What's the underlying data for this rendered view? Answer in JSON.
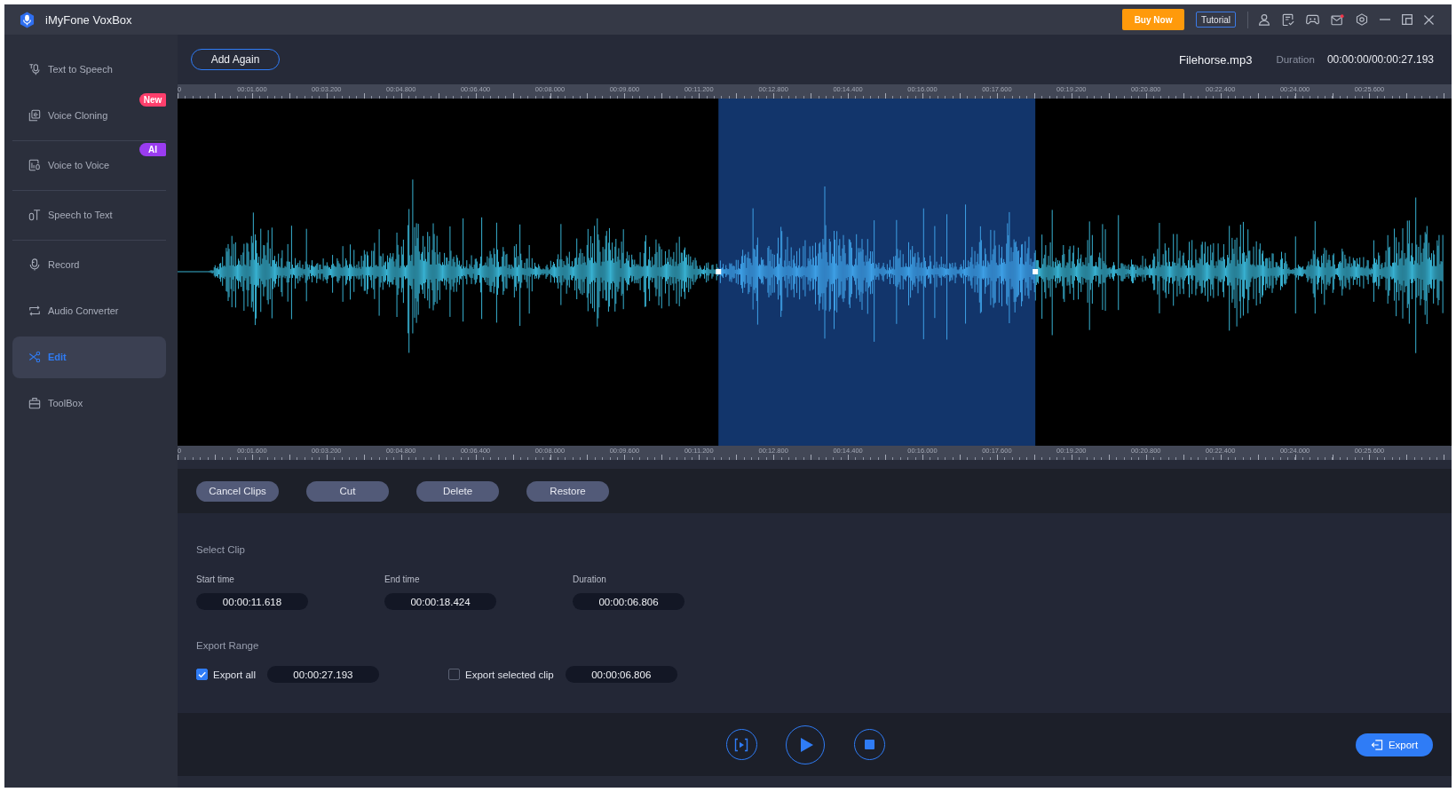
{
  "title_bar": {
    "app_name": "iMyFone VoxBox",
    "buy_button": "Buy Now",
    "tutorial_button": "Tutorial",
    "mail_unread": true
  },
  "sidebar": {
    "groups": [
      {
        "items": [
          {
            "label": "Text to Speech",
            "selected": false
          },
          {
            "label": "Voice Cloning",
            "selected": false,
            "badge": {
              "text": "New",
              "color": "#ff3f6c"
            }
          }
        ]
      },
      {
        "items": [
          {
            "label": "Voice to Voice",
            "selected": false,
            "badge": {
              "text": "AI",
              "color": "#9a3cf0"
            }
          }
        ]
      },
      {
        "items": [
          {
            "label": "Speech to Text",
            "selected": false
          }
        ]
      },
      {
        "items": [
          {
            "label": "Record",
            "selected": false
          },
          {
            "label": "Audio Converter",
            "selected": false
          },
          {
            "label": "Edit",
            "selected": true
          },
          {
            "label": "ToolBox",
            "selected": false
          }
        ]
      }
    ]
  },
  "editor": {
    "add_button": "Add Again",
    "file_name": "Filehorse.mp3",
    "duration_label": "Duration",
    "position": "00:00:00/00:00:27.193"
  },
  "top_ruler": {
    "labels": [
      "0",
      "00:01.600",
      "00:03.200",
      "00:04.800",
      "00:06.400",
      "00:08.000",
      "00:09.600",
      "00:11.200",
      "00:12.800",
      "00:14.400",
      "00:16.000",
      "00:17.600",
      "00:19.200",
      "00:20.800",
      "00:22.400",
      "00:24.000",
      "00:25.600"
    ]
  },
  "bottom_ruler": {
    "labels": [
      "0",
      "00:01.600",
      "00:03.200",
      "00:04.800",
      "00:06.400",
      "00:08.000",
      "00:09.600",
      "00:11.200",
      "00:12.800",
      "00:14.400",
      "00:16.000",
      "00:17.600",
      "00:19.200",
      "00:20.800",
      "00:22.400",
      "00:24.000",
      "00:25.600"
    ]
  },
  "clip_buttons": [
    "Cancel Clips",
    "Cut",
    "Delete",
    "Restore"
  ],
  "select_clip": {
    "title": "Select Clip",
    "fields": [
      {
        "label": "Start time",
        "value": "00:00:11.618"
      },
      {
        "label": "End time",
        "value": "00:00:18.424"
      },
      {
        "label": "Duration",
        "value": "00:00:06.806"
      }
    ]
  },
  "export_range": {
    "title": "Export Range",
    "options": [
      {
        "label": "Export all",
        "checked": true,
        "value": "00:00:27.193"
      },
      {
        "label": "Export selected clip",
        "checked": false,
        "value": "00:00:06.806"
      }
    ]
  },
  "export_button": "Export"
}
